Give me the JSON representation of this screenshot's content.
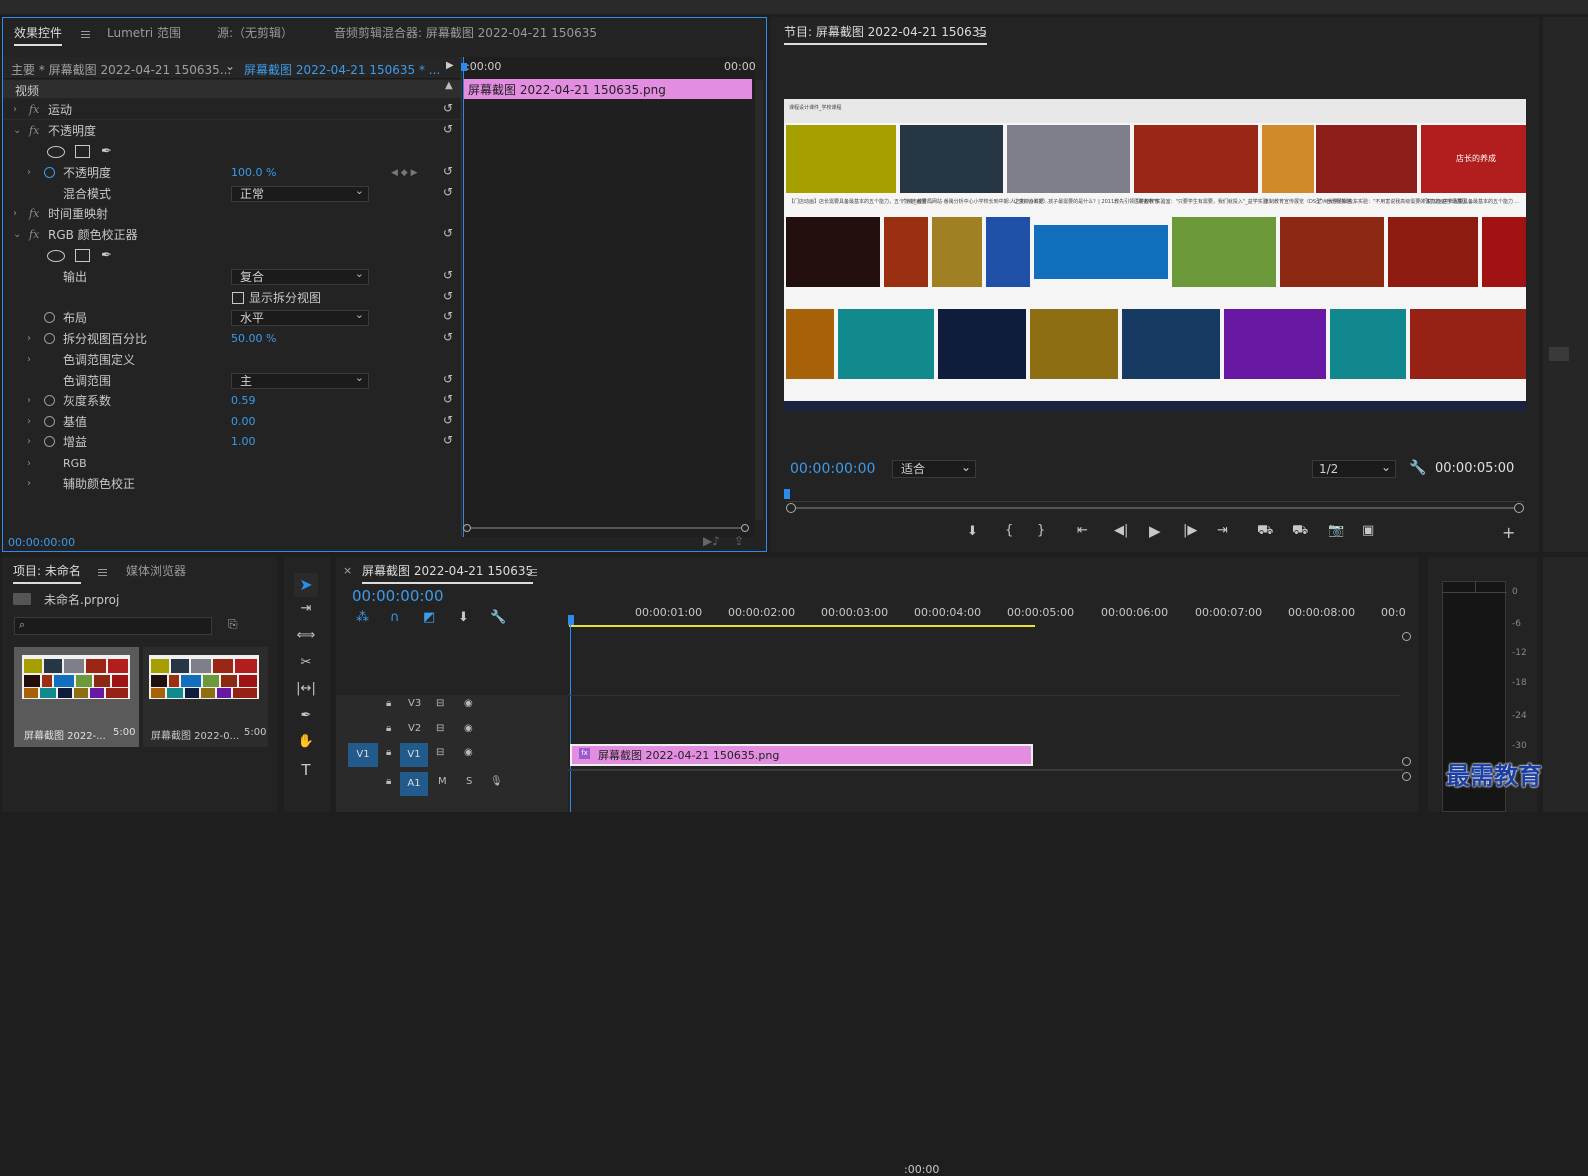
{
  "effect_controls": {
    "tabs": [
      "效果控件",
      "Lumetri 范围",
      "源:（无剪辑）",
      "音频剪辑混合器: 屏幕截图 2022-04-21 150635"
    ],
    "master_label": "主要 * 屏幕截图 2022-04-21 150635...",
    "clip_label": "屏幕截图 2022-04-21 150635 * ...",
    "time_start": ":00:00",
    "time_end": "00:00",
    "clip_bar": "屏幕截图 2022-04-21  150635.png",
    "section_video": "视频",
    "effects": {
      "motion": "运动",
      "opacity": "不透明度",
      "opacity_param": "不透明度",
      "opacity_value": "100.0 %",
      "blend_mode": "混合模式",
      "blend_value": "正常",
      "time_remap": "时间重映射",
      "rgb_corrector": "RGB 颜色校正器",
      "output": "输出",
      "output_value": "复合",
      "split_view": "显示拆分视图",
      "layout": "布局",
      "layout_value": "水平",
      "split_percent": "拆分视图百分比",
      "split_percent_value": "50.00 %",
      "tonal_range_def": "色调范围定义",
      "tonal_range": "色调范围",
      "tonal_range_value": "主",
      "gamma": "灰度系数",
      "gamma_value": "0.59",
      "pedestal": "基值",
      "pedestal_value": "0.00",
      "gain": "增益",
      "gain_value": "1.00",
      "rgb": "RGB",
      "secondary": "辅助颜色校正"
    },
    "timecode": "00:00:00:00"
  },
  "program_monitor": {
    "title": "节目: 屏幕截图 2022-04-21 150635",
    "timecode": "00:00:00:00",
    "fit": "适合",
    "resolution": "1/2",
    "duration": "00:00:05:00",
    "thumb_captions": [
      "【门店动画】店长需要具备最基本的五个能力，五个技能_画图 ...",
      "广州市教育局网站·番禺分析中心小学校长到中期：让感谢合影据 ...",
      "人之初（0-6岁）孩子最需要的是什么？| 2011教先引领医学校教育 ...",
      "\"最金中\"实验室：\"只要学生有需要，我们就投入\"_益学实验 ...",
      "法制教育宣传展览（DS型）自愿服务学...",
      "广州大学附属金东实验：\"不用害说我高级需要的体力方 在学场基区 ...",
      "门店动画店长需要具备最基本的五个能力 ...",
      "店长的养成"
    ]
  },
  "project": {
    "tabs": [
      "项目: 未命名",
      "媒体浏览器"
    ],
    "file": "未命名.prproj",
    "items": [
      {
        "name": "屏幕截图 2022-...",
        "duration": "5:00"
      },
      {
        "name": "屏幕截图 2022-0...",
        "duration": "5:00"
      }
    ]
  },
  "timeline": {
    "title": "屏幕截图 2022-04-21 150635",
    "timecode": "00:00:00:00",
    "ruler": [
      ":00:00",
      "00:00:01:00",
      "00:00:02:00",
      "00:00:03:00",
      "00:00:04:00",
      "00:00:05:00",
      "00:00:06:00",
      "00:00:07:00",
      "00:00:08:00",
      "00:0"
    ],
    "tracks": [
      "V3",
      "V2",
      "V1",
      "A1"
    ],
    "source_patch": "V1",
    "clip_name": "屏幕截图 2022-04-21  150635.png",
    "audio_m": "M",
    "audio_s": "S"
  },
  "meter_labels": [
    "0",
    "-6",
    "-12",
    "-18",
    "-24",
    "-30"
  ],
  "watermark": "最需教育",
  "colors": {
    "accent": "#2d8ceb",
    "clip": "#e38de0",
    "panel": "#232323"
  }
}
